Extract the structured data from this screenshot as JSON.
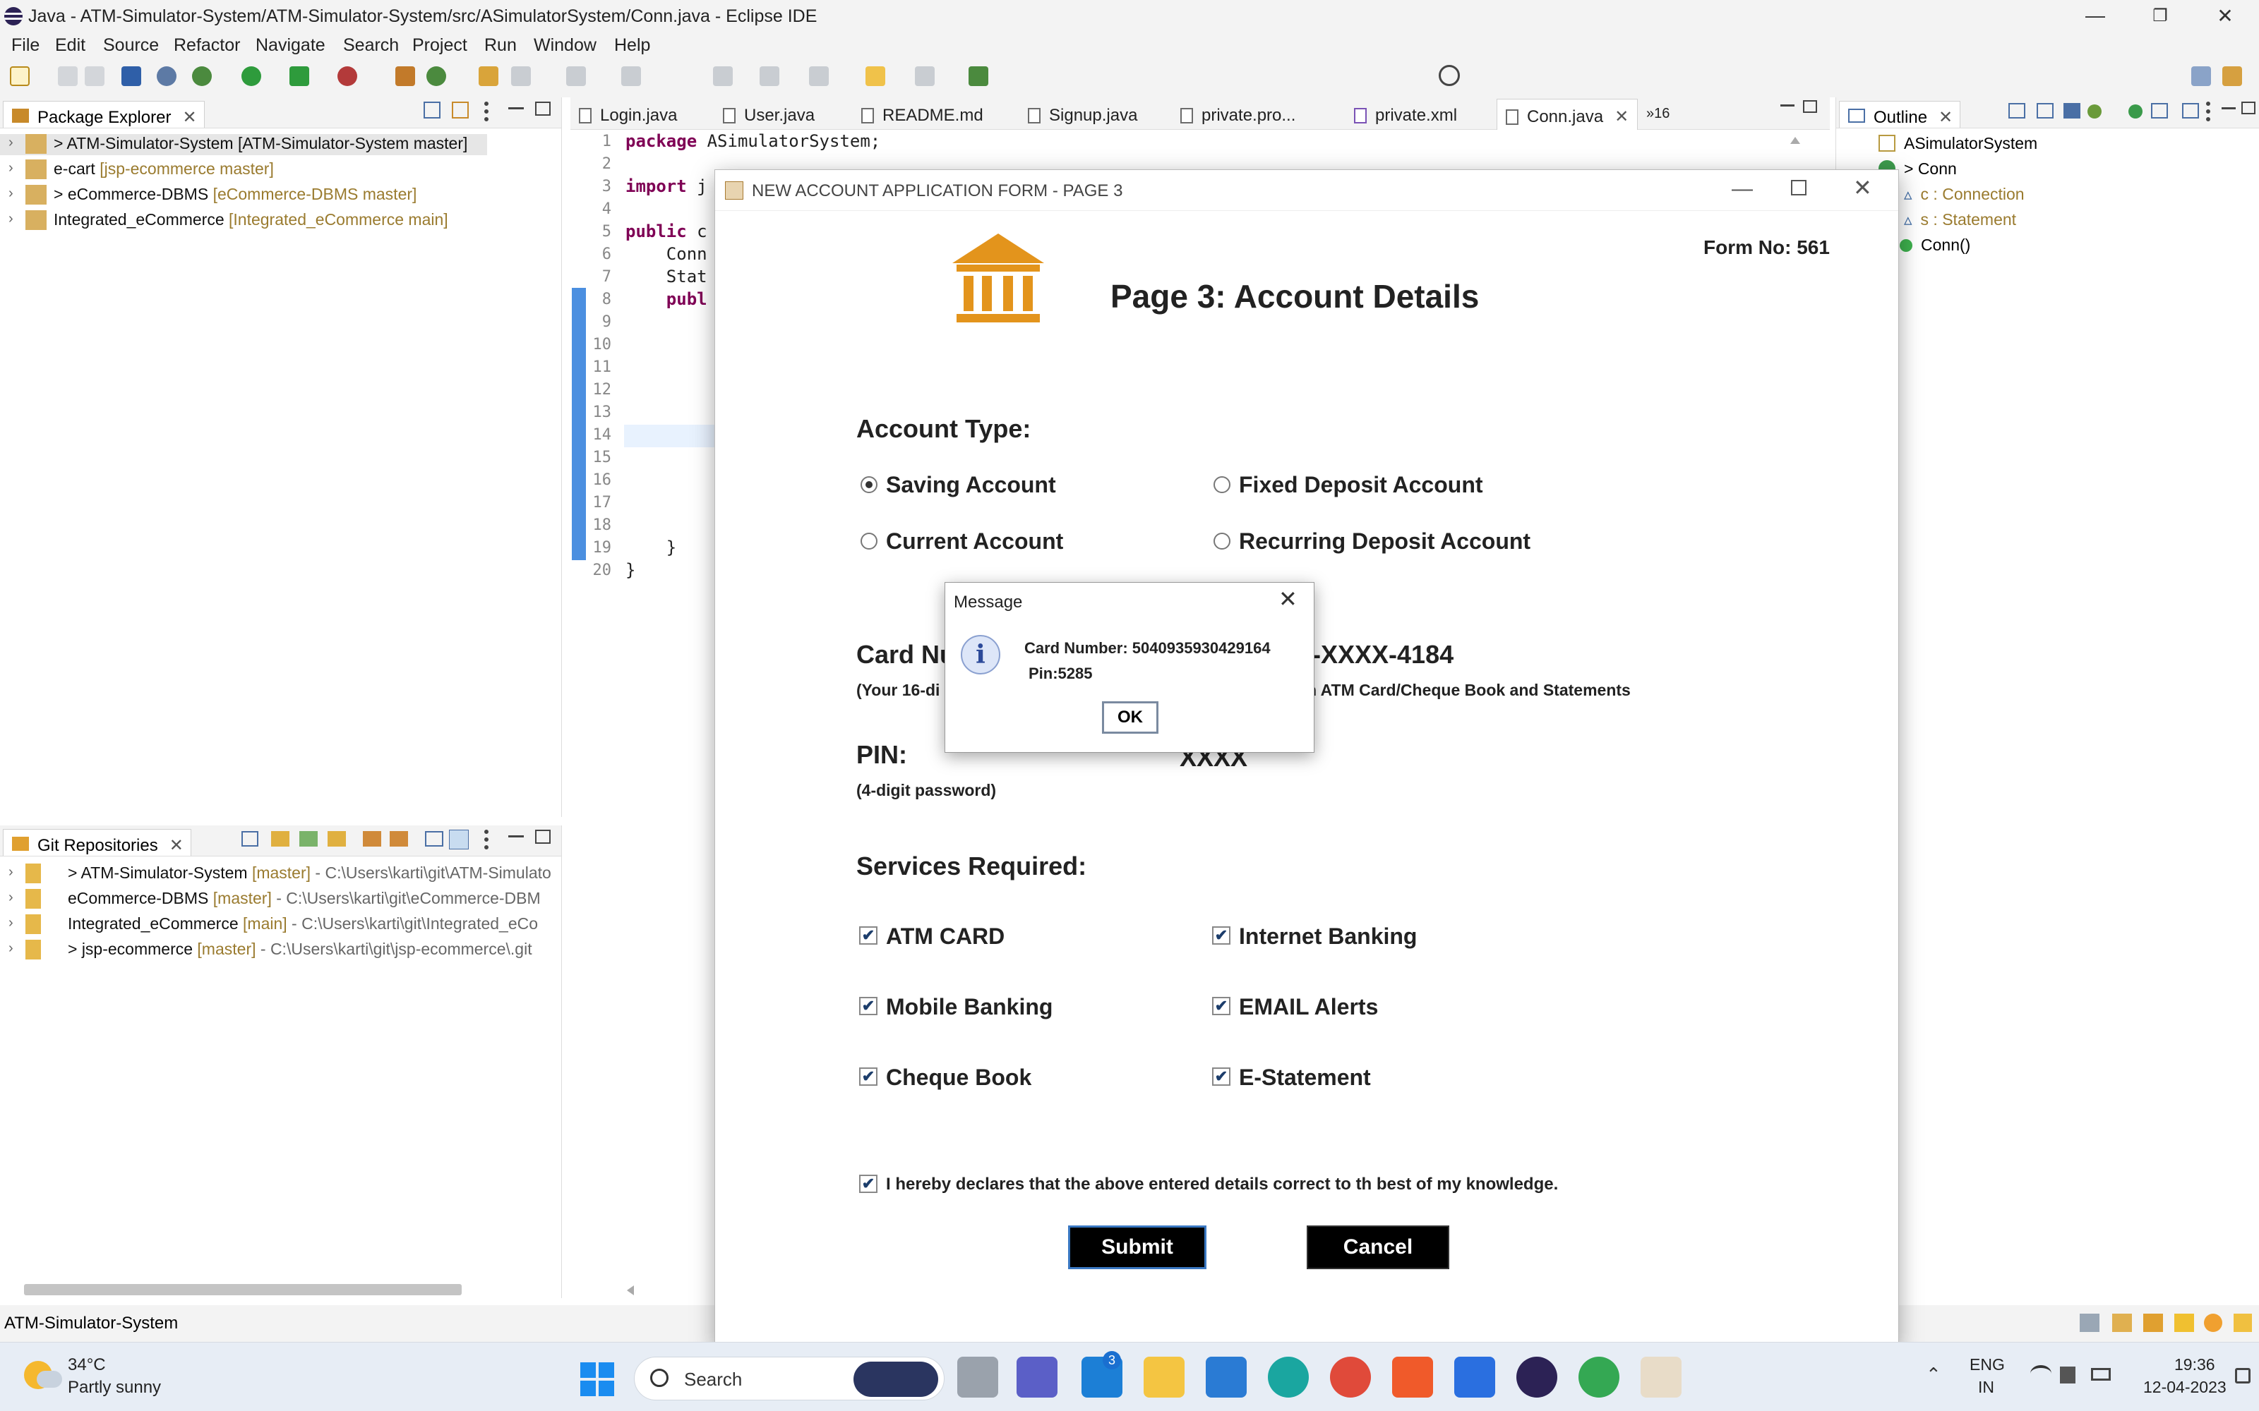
{
  "window": {
    "title": "Java - ATM-Simulator-System/ATM-Simulator-System/src/ASimulatorSystem/Conn.java - Eclipse IDE",
    "minimize": "—",
    "maximize": "❐",
    "close": "✕"
  },
  "menu": [
    "File",
    "Edit",
    "Source",
    "Refactor",
    "Navigate",
    "Search",
    "Project",
    "Run",
    "Window",
    "Help"
  ],
  "package_explorer": {
    "title": "Package Explorer",
    "items": [
      {
        "name": "> ATM-Simulator-System",
        "decoration": "[ATM-Simulator-System master]"
      },
      {
        "name": "e-cart",
        "decoration": "[jsp-ecommerce master]"
      },
      {
        "name": "> eCommerce-DBMS",
        "decoration": "[eCommerce-DBMS master]"
      },
      {
        "name": "Integrated_eCommerce",
        "decoration": "[Integrated_eCommerce main]"
      }
    ]
  },
  "git_repositories": {
    "title": "Git Repositories",
    "items": [
      {
        "name": "> ATM-Simulator-System",
        "branch": "[master]",
        "path": "- C:\\Users\\karti\\git\\ATM-Simulato"
      },
      {
        "name": "eCommerce-DBMS",
        "branch": "[master]",
        "path": "- C:\\Users\\karti\\git\\eCommerce-DBM"
      },
      {
        "name": "Integrated_eCommerce",
        "branch": "[main]",
        "path": "- C:\\Users\\karti\\git\\Integrated_eCo"
      },
      {
        "name": "> jsp-ecommerce",
        "branch": "[master]",
        "path": "- C:\\Users\\karti\\git\\jsp-ecommerce\\.git"
      }
    ]
  },
  "editor": {
    "tabs": [
      "Login.java",
      "User.java",
      "README.md",
      "Signup.java",
      "private.pro...",
      "private.xml",
      "Conn.java"
    ],
    "overflow": "»16",
    "line_numbers": [
      "1",
      "2",
      "3",
      "4",
      "5",
      "6",
      "7",
      "8",
      "9",
      "10",
      "11",
      "12",
      "13",
      "14",
      "15",
      "16",
      "17",
      "18",
      "19",
      "20"
    ],
    "lines": [
      {
        "kw": "package",
        "text": " ASimulatorSystem;"
      },
      {
        "kw": "import",
        "text": " j"
      },
      {
        "kw": "public",
        "text": " c"
      },
      {
        "kw": "",
        "text": "    Conn"
      },
      {
        "kw": "",
        "text": "    Stat"
      },
      {
        "kw": "",
        "text": "    publ"
      },
      {
        "kw": "",
        "text": "    }"
      },
      {
        "kw": "",
        "text": "}"
      }
    ]
  },
  "outline": {
    "title": "Outline",
    "items": [
      "ASimulatorSystem",
      "> Conn",
      "c : Connection",
      "s : Statement",
      "Conn()"
    ]
  },
  "form": {
    "window_title": "NEW ACCOUNT APPLICATION FORM - PAGE 3",
    "form_no_label": "Form No:",
    "form_no": "561",
    "heading": "Page 3: Account Details",
    "account_type_label": "Account Type:",
    "account_types": [
      "Saving Account",
      "Fixed Deposit Account",
      "Current Account",
      "Recurring Deposit Account"
    ],
    "card_label": "Card Nu",
    "card_value": "X-XXXX-4184",
    "card_hint_left": "(Your 16-di",
    "card_hint_right": "on ATM Card/Cheque Book and Statements",
    "pin_label": "PIN:",
    "pin_value": "XXXX",
    "pin_hint": "(4-digit password)",
    "services_label": "Services Required:",
    "services": [
      "ATM CARD",
      "Internet Banking",
      "Mobile Banking",
      "EMAIL Alerts",
      "Cheque Book",
      "E-Statement"
    ],
    "check_mark": "✔",
    "declaration": "I hereby declares that the above entered details correct to th best of my knowledge.",
    "submit": "Submit",
    "cancel": "Cancel"
  },
  "message": {
    "title": "Message",
    "line1": "Card Number: 5040935930429164",
    "line2": "Pin:5285",
    "ok": "OK",
    "info_glyph": "i"
  },
  "status": {
    "text": "ATM-Simulator-System"
  },
  "taskbar": {
    "temp": "34°C",
    "weather": "Partly sunny",
    "search": "Search",
    "mail_badge": "3",
    "lang1": "ENG",
    "lang2": "IN",
    "time": "19:36",
    "date": "12-04-2023"
  },
  "colors": {
    "accent": "#e3941c",
    "eclipse_bg": "#f3f3f3",
    "keyword": "#7f0055",
    "decoration": "#9a7b2f"
  }
}
